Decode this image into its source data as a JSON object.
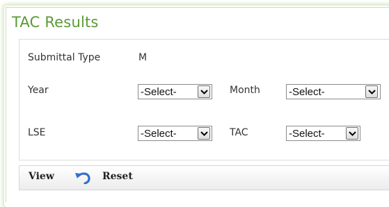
{
  "panel": {
    "title": "TAC Results"
  },
  "form": {
    "submittal_type_label": "Submittal Type",
    "submittal_type_value": "M",
    "year_label": "Year",
    "year_value": "-Select-",
    "month_label": "Month",
    "month_value": "-Select-",
    "lse_label": "LSE",
    "lse_value": "-Select-",
    "tac_label": "TAC",
    "tac_value": "-Select-"
  },
  "toolbar": {
    "view_label": "View",
    "reset_label": "Reset"
  },
  "icons": {
    "reset": "undo-arrow-icon",
    "dropdown": "chevron-down-icon"
  },
  "colors": {
    "title": "#5a9a35",
    "frame_glow": "#aacd82",
    "reset_icon": "#2f6fcf"
  }
}
